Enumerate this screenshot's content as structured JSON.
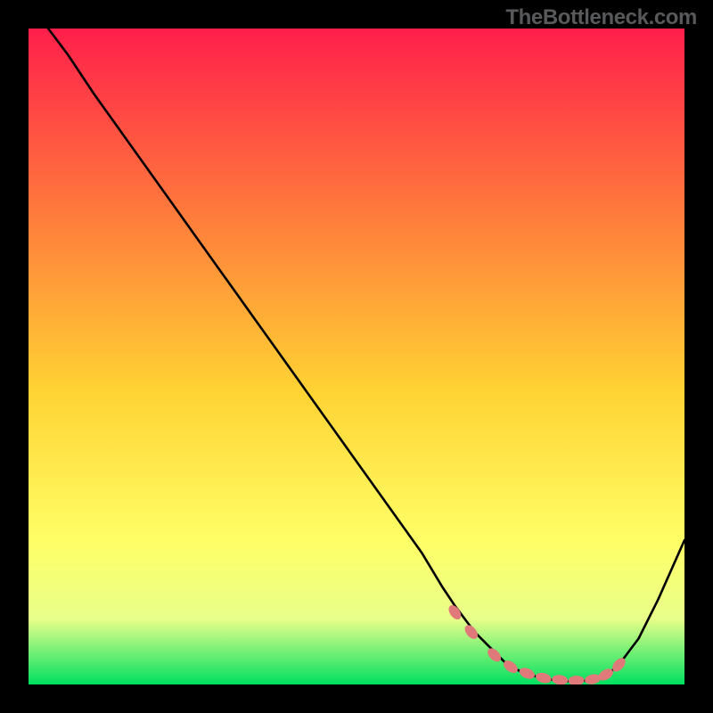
{
  "watermark": "TheBottleneck.com",
  "colors": {
    "gradient_top": "#ff1f4b",
    "gradient_mid1": "#ff7a3c",
    "gradient_mid2": "#ffd233",
    "gradient_mid3": "#ffff66",
    "gradient_mid4": "#e8ff8a",
    "gradient_bottom": "#00e060",
    "curve": "#000000",
    "marker": "#e07a7a"
  },
  "chart_data": {
    "type": "line",
    "title": "",
    "xlabel": "",
    "ylabel": "",
    "xlim": [
      0,
      100
    ],
    "ylim": [
      0,
      100
    ],
    "series": [
      {
        "name": "bottleneck-curve",
        "x": [
          3,
          6,
          10,
          15,
          20,
          25,
          30,
          35,
          40,
          45,
          50,
          55,
          60,
          63,
          65,
          68,
          71,
          73,
          75,
          78,
          80,
          82,
          84,
          86,
          88,
          90,
          93,
          96,
          100
        ],
        "y": [
          100,
          96,
          90,
          83,
          76,
          69,
          62,
          55,
          48,
          41,
          34,
          27,
          20,
          15,
          12,
          8,
          5,
          3,
          2,
          1,
          0.7,
          0.5,
          0.5,
          0.7,
          1.3,
          3,
          7,
          13,
          22
        ]
      }
    ],
    "markers": {
      "name": "highlight-dots",
      "x": [
        65,
        67.5,
        71,
        73.5,
        76,
        78.5,
        81,
        83.5,
        86,
        88,
        90
      ],
      "y": [
        11,
        8,
        4.5,
        2.7,
        1.7,
        1,
        0.7,
        0.6,
        0.8,
        1.5,
        3
      ]
    }
  }
}
